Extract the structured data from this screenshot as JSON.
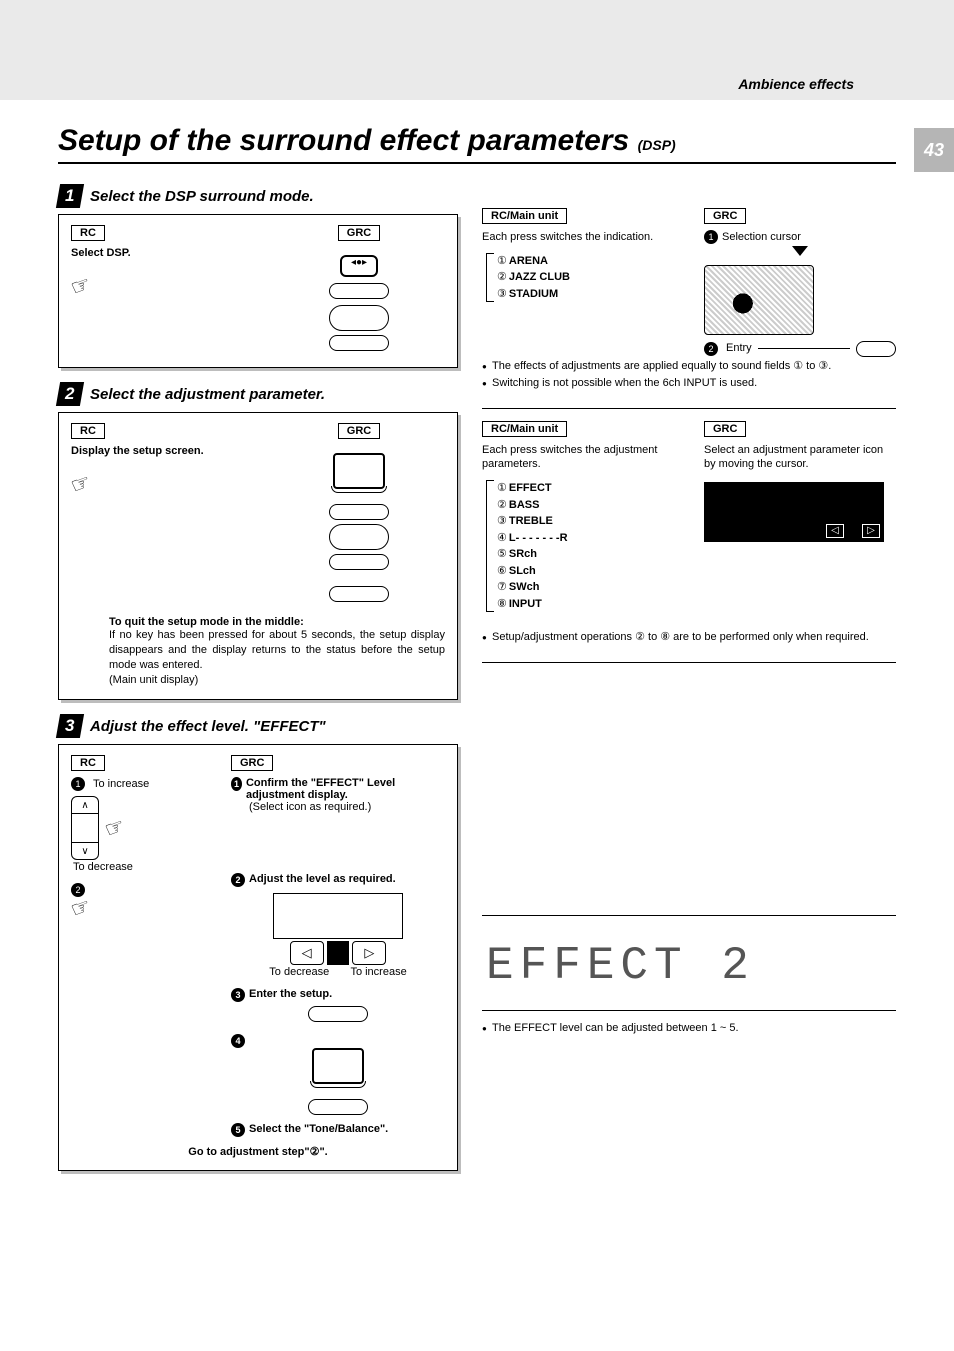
{
  "header": {
    "breadcrumb": "Ambience effects",
    "title_main": "Setup of the surround effect parameters",
    "title_sub": "(DSP)",
    "page_number": "43"
  },
  "steps": {
    "s1": {
      "num": "1",
      "heading": "Select the DSP surround mode."
    },
    "s2": {
      "num": "2",
      "heading": "Select the adjustment parameter."
    },
    "s3": {
      "num": "3",
      "heading": "Adjust the effect level. \"EFFECT\""
    }
  },
  "labels": {
    "rc": "RC",
    "grc": "GRC",
    "rc_main": "RC/Main unit",
    "select_dsp": "Select DSP.",
    "display_setup": "Display the setup screen.",
    "to_increase": "To increase",
    "to_decrease": "To decrease",
    "entry": "Entry",
    "selection_cursor": "Selection cursor"
  },
  "box1_right": {
    "intro": "Each press switches the indication.",
    "items": [
      "ARENA",
      "JAZZ CLUB",
      "STADIUM"
    ],
    "nums": [
      "①",
      "②",
      "③"
    ],
    "note1": "The effects of adjustments are applied equally to sound fields ① to ③.",
    "note2": "Switching is not possible when the 6ch INPUT is used."
  },
  "box2_right": {
    "intro_l": "Each press switches the adjustment parameters.",
    "intro_r": "Select an adjustment parameter icon by moving the cursor.",
    "items": [
      "EFFECT",
      "BASS",
      "TREBLE",
      "L- - - - - - -R",
      "SRch",
      "SLch",
      "SWch",
      "INPUT"
    ],
    "nums": [
      "①",
      "②",
      "③",
      "④",
      "⑤",
      "⑥",
      "⑦",
      "⑧"
    ],
    "note": "Setup/adjustment operations ② to ⑧ are to be performed only when required."
  },
  "box2_quit": {
    "head": "To quit the setup mode in the middle:",
    "body": "If no key has been pressed for about 5 seconds, the setup display disappears and the display returns to the status before the setup mode was entered.",
    "tail": "(Main unit display)"
  },
  "box3": {
    "g1_head": "Confirm the \"EFFECT\" Level adjustment display.",
    "g1_sub": "(Select icon as required.)",
    "g2": "Adjust the level as required.",
    "g3": "Enter the setup.",
    "g5": "Select  the \"Tone/Balance\".",
    "footer": "Go to adjustment step\"②\"."
  },
  "lcd": {
    "text": "EFFECT    2",
    "note": "The EFFECT level can be adjusted between 1 ~ 5."
  }
}
